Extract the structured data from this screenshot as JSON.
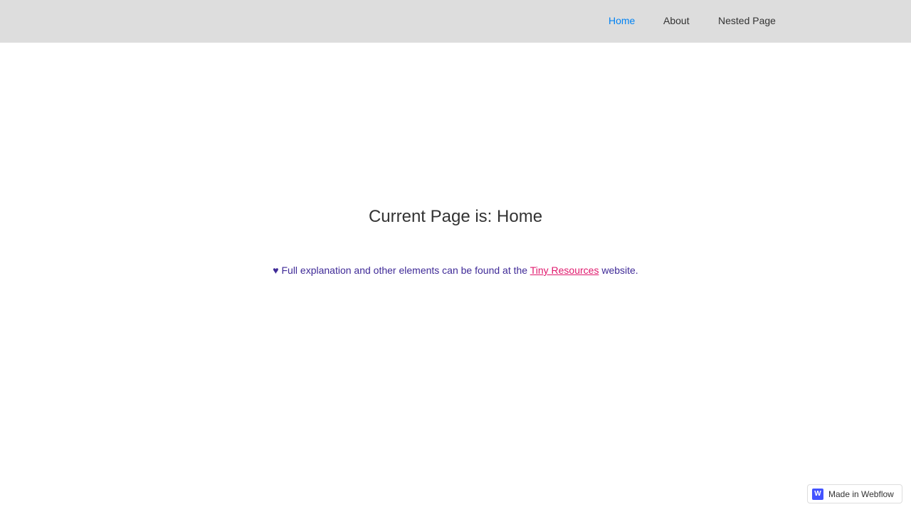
{
  "nav": {
    "items": [
      {
        "label": "Home",
        "active": true
      },
      {
        "label": "About"
      },
      {
        "label": "Nested Page"
      }
    ]
  },
  "main": {
    "title": "Current Page is: Home",
    "note": {
      "heart": "♥",
      "before": " Full explanation and other elements can be found at the ",
      "link": "Tiny Resources",
      "after": " website."
    }
  },
  "badge": {
    "logo": "W",
    "label": "Made in Webflow"
  },
  "colors": {
    "nav_bg": "#dddddd",
    "active": "#0082f3",
    "note": "#3f2a97",
    "link": "#e0186c"
  }
}
